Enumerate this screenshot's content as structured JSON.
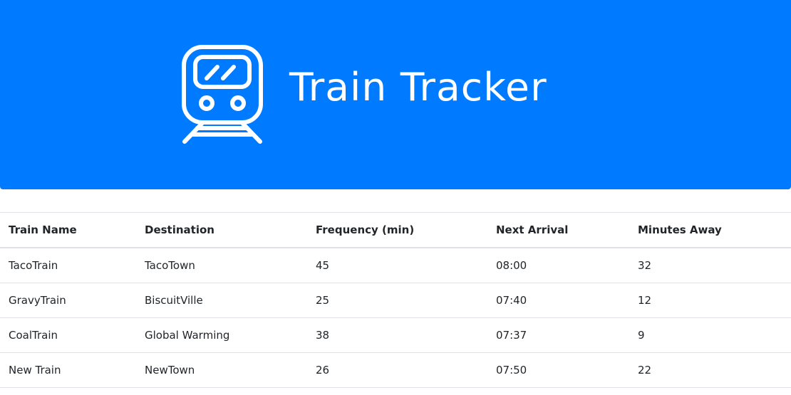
{
  "header": {
    "title": "Train Tracker",
    "background_color": "#007bff",
    "icon": "train-icon"
  },
  "table": {
    "columns": [
      "Train Name",
      "Destination",
      "Frequency (min)",
      "Next Arrival",
      "Minutes Away"
    ],
    "rows": [
      {
        "name": "TacoTrain",
        "destination": "TacoTown",
        "frequency": "45",
        "next_arrival": "08:00",
        "minutes_away": "32"
      },
      {
        "name": "GravyTrain",
        "destination": "BiscuitVille",
        "frequency": "25",
        "next_arrival": "07:40",
        "minutes_away": "12"
      },
      {
        "name": "CoalTrain",
        "destination": "Global Warming",
        "frequency": "38",
        "next_arrival": "07:37",
        "minutes_away": "9"
      },
      {
        "name": "New Train",
        "destination": "NewTown",
        "frequency": "26",
        "next_arrival": "07:50",
        "minutes_away": "22"
      }
    ]
  }
}
